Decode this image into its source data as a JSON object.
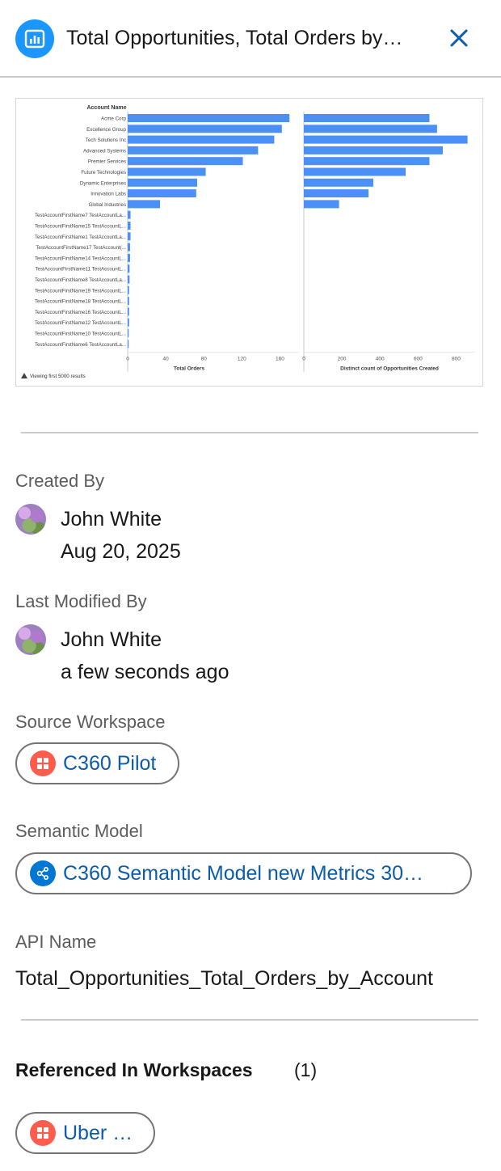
{
  "header": {
    "title": "Total Opportunities, Total Orders by…",
    "icon": "bar-chart-icon",
    "icon_color": "#1b96ff"
  },
  "chart_data": {
    "type": "bar",
    "orientation": "horizontal",
    "yaxis_title": "Account Name",
    "categories": [
      "Acme Corp",
      "Excellence Group",
      "Tech Solutions Inc",
      "Advanced Systems",
      "Premier Services",
      "Future Technologies",
      "Dynamic Enterprises",
      "Innovation Labs",
      "Global Industries",
      "TestAccountFirstName7 TestAccountLa...",
      "TestAccountFirstName15 TestAccountL...",
      "TestAccountFirstName1 TestAccountLa...",
      "TestAccountFirstName17 TestAccount(...",
      "TestAccountFirstName14 TestAccountL...",
      "TestAccountFirstName11 TestAccountL...",
      "TestAccountFirstName8 TestAccountLa...",
      "TestAccountFirstName19 TestAccountL...",
      "TestAccountFirstName18 TestAccountL...",
      "TestAccountFirstName16 TestAccountL...",
      "TestAccountFirstName12 TestAccountL...",
      "TestAccountFirstName10 TestAccountL...",
      "TestAccountFirstName6 TestAccountLa..."
    ],
    "series": [
      {
        "name": "Total Orders",
        "color": "#4a90f7",
        "xlim": [
          0,
          180
        ],
        "ticks": [
          "0",
          "40",
          "80",
          "120",
          "160"
        ],
        "values": [
          170,
          162,
          154,
          137,
          121,
          82,
          73,
          72,
          34,
          3,
          3,
          3,
          2.5,
          2.5,
          2,
          2,
          1.5,
          1.5,
          1.5,
          1.5,
          1,
          1
        ]
      },
      {
        "name": "Distinct count of Opportunities Created",
        "color": "#4a90f7",
        "xlim": [
          0,
          900
        ],
        "ticks": [
          "0",
          "200",
          "400",
          "600",
          "800"
        ],
        "values": [
          660,
          700,
          860,
          730,
          660,
          535,
          365,
          340,
          185,
          0,
          0,
          0,
          0,
          0,
          0,
          0,
          0,
          0,
          0,
          0,
          0,
          0
        ]
      }
    ],
    "footnote": "Viewing first 5000 results",
    "grid": false
  },
  "created_by": {
    "label": "Created By",
    "name": "John White",
    "date": "Aug 20, 2025"
  },
  "last_modified_by": {
    "label": "Last Modified By",
    "name": "John White",
    "date": "a few seconds ago"
  },
  "source_workspace": {
    "label": "Source Workspace",
    "value": "C360 Pilot",
    "icon": "workspace-grid-icon",
    "icon_color": "#fe5c4c"
  },
  "semantic_model": {
    "label": "Semantic Model",
    "value": "C360 Semantic Model new Metrics 30…",
    "icon": "semantic-model-icon",
    "icon_color": "#0176d3"
  },
  "api_name": {
    "label": "API Name",
    "value": "Total_Opportunities_Total_Orders_by_Account"
  },
  "referenced_in": {
    "title": "Referenced In Workspaces",
    "count": "(1)",
    "items": [
      "Uber PE"
    ]
  }
}
